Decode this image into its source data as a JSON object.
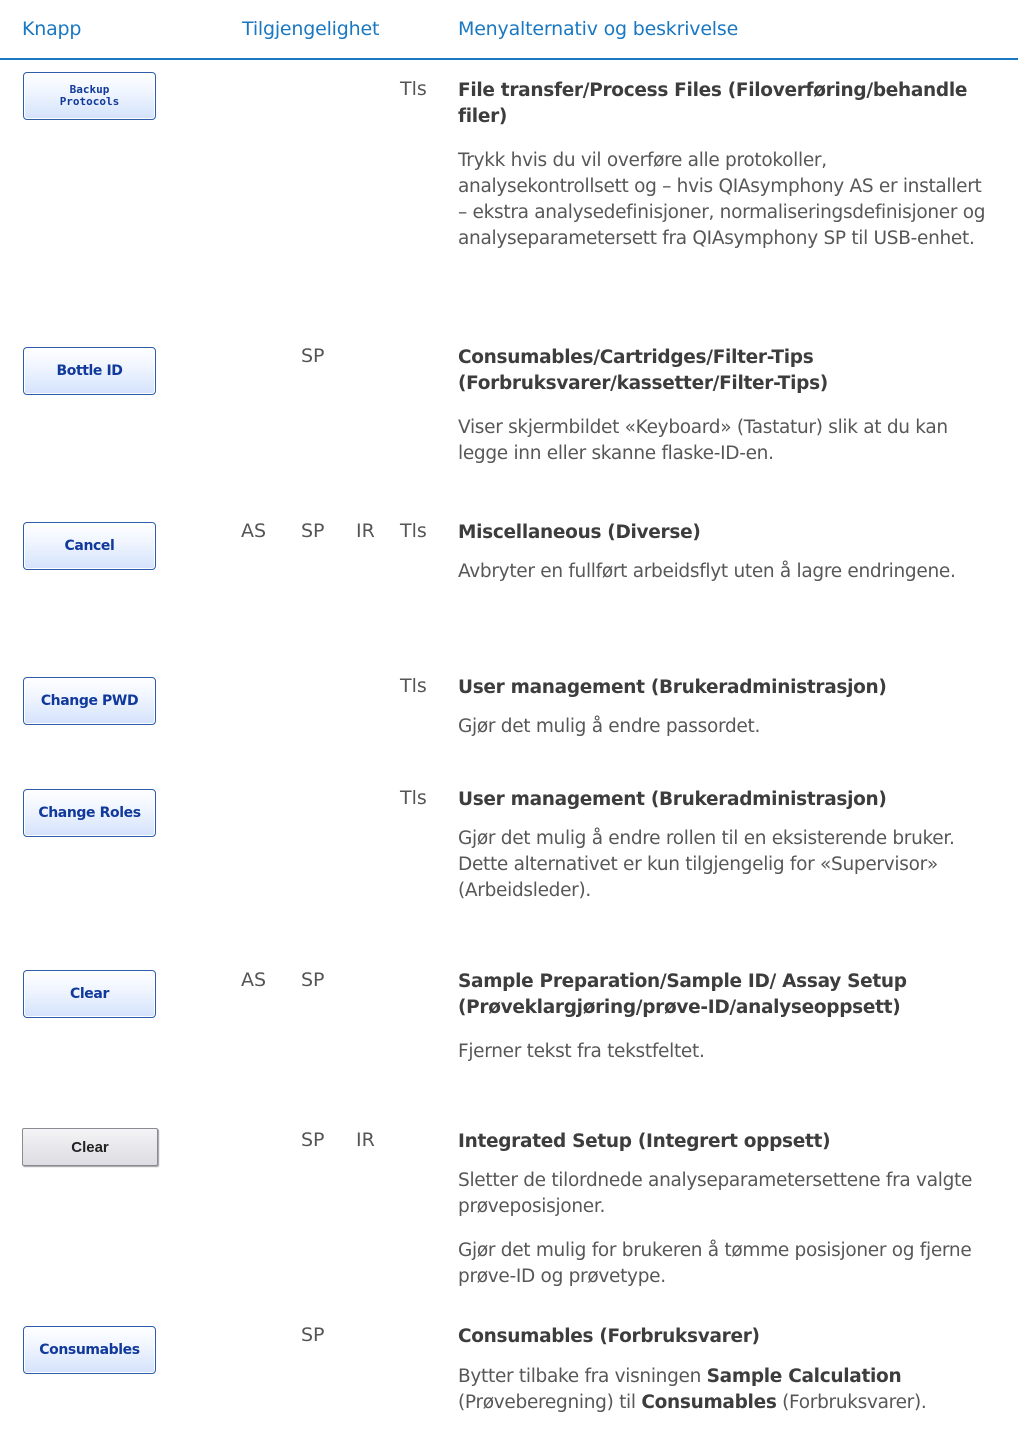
{
  "header": {
    "col_button": "Knapp",
    "col_availability": "Tilgjengelighet",
    "col_menu": "Menyalternativ og beskrivelse"
  },
  "rows": [
    {
      "button": "Backup\nProtocols",
      "availability": {
        "as": "",
        "sp": "",
        "ir": "",
        "tls": "Tls"
      },
      "menu": "File transfer/Process Files (Filoverføring/behandle filer)",
      "descriptions": [
        "Trykk hvis du vil overføre alle protokoller, analysekontrollsett og – hvis QIAsymphony AS er installert – ekstra analysedefinisjoner, normaliseringsdefinisjoner og analyseparametersett fra QIAsymphony SP til USB-enhet."
      ]
    },
    {
      "button": "Bottle ID",
      "availability": {
        "as": "",
        "sp": "SP",
        "ir": "",
        "tls": ""
      },
      "menu": "Consumables/Cartridges/Filter-Tips (Forbruksvarer/kassetter/Filter-Tips)",
      "descriptions": [
        "Viser skjermbildet «Keyboard» (Tastatur) slik at du kan legge inn eller skanne flaske-ID-en."
      ]
    },
    {
      "button": "Cancel",
      "availability": {
        "as": "AS",
        "sp": "SP",
        "ir": "IR",
        "tls": "Tls"
      },
      "menu": "Miscellaneous (Diverse)",
      "descriptions": [
        "Avbryter en fullført arbeidsflyt uten å lagre endringene."
      ]
    },
    {
      "button": "Change PWD",
      "availability": {
        "as": "",
        "sp": "",
        "ir": "",
        "tls": "Tls"
      },
      "menu": "User management (Brukeradministrasjon)",
      "descriptions": [
        "Gjør det mulig å endre passordet."
      ]
    },
    {
      "button": "Change Roles",
      "availability": {
        "as": "",
        "sp": "",
        "ir": "",
        "tls": "Tls"
      },
      "menu": "User management (Brukeradministrasjon)",
      "descriptions": [
        "Gjør det mulig å endre rollen til en eksisterende bruker. Dette alternativet er kun tilgjengelig for «Supervisor» (Arbeidsleder)."
      ]
    },
    {
      "button": "Clear",
      "availability": {
        "as": "AS",
        "sp": "SP",
        "ir": "",
        "tls": ""
      },
      "menu": "Sample Preparation/Sample ID/ Assay Setup (Prøveklargjøring/prøve-ID/analyseoppsett)",
      "descriptions": [
        "Fjerner tekst fra tekstfeltet."
      ]
    },
    {
      "button": "Clear",
      "availability": {
        "as": "",
        "sp": "SP",
        "ir": "IR",
        "tls": ""
      },
      "menu": "Integrated Setup (Integrert oppsett)",
      "descriptions": [
        "Sletter de tilordnede analyseparametersettene fra valgte prøveposisjoner.",
        "Gjør det mulig for brukeren å tømme posisjoner og fjerne prøve-ID og prøvetype."
      ]
    },
    {
      "button": "Consumables",
      "availability": {
        "as": "",
        "sp": "SP",
        "ir": "",
        "tls": ""
      },
      "menu": "Consumables (Forbruksvarer)",
      "descriptions": [
        {
          "p1": "Bytter tilbake fra visningen ",
          "b1": "Sample Calculation",
          "p2": " (Prøveberegning) til ",
          "b2": "Consumables",
          "p3": " (Forbruksvarer)."
        }
      ]
    }
  ]
}
